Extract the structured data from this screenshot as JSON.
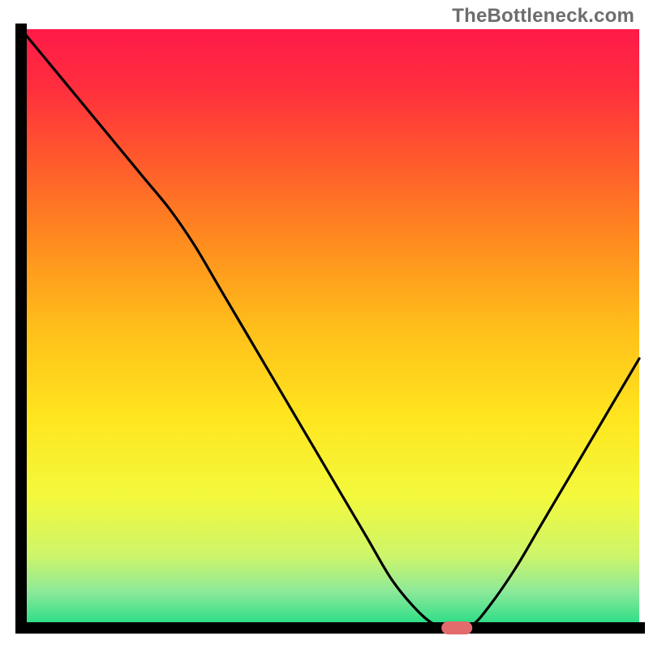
{
  "watermark": "TheBottleneck.com",
  "chart_data": {
    "type": "line",
    "title": "",
    "xlabel": "",
    "ylabel": "",
    "xlim": [
      0,
      100
    ],
    "ylim": [
      0,
      100
    ],
    "x": [
      0,
      4,
      8,
      12,
      16,
      20,
      24,
      28,
      32,
      36,
      40,
      44,
      48,
      52,
      56,
      60,
      64,
      67,
      70,
      73,
      76,
      80,
      84,
      88,
      92,
      96,
      100
    ],
    "values": [
      100,
      95,
      90,
      85,
      80,
      75,
      70,
      64,
      57,
      50,
      43,
      36,
      29,
      22,
      15,
      8,
      3,
      0.5,
      0,
      0.5,
      4,
      10,
      17,
      24,
      31,
      38,
      45
    ],
    "marker": {
      "x": 70.5,
      "y": 0
    },
    "gradient_stops": [
      {
        "offset": 0.0,
        "color": "#ff1a49"
      },
      {
        "offset": 0.1,
        "color": "#ff2f3e"
      },
      {
        "offset": 0.22,
        "color": "#ff5a2c"
      },
      {
        "offset": 0.35,
        "color": "#ff8a1f"
      },
      {
        "offset": 0.5,
        "color": "#ffbf1a"
      },
      {
        "offset": 0.65,
        "color": "#ffe61f"
      },
      {
        "offset": 0.78,
        "color": "#f3f93d"
      },
      {
        "offset": 0.88,
        "color": "#cdf56a"
      },
      {
        "offset": 0.94,
        "color": "#8ce99a"
      },
      {
        "offset": 1.0,
        "color": "#1fdc84"
      }
    ],
    "frame_color": "#000000"
  }
}
